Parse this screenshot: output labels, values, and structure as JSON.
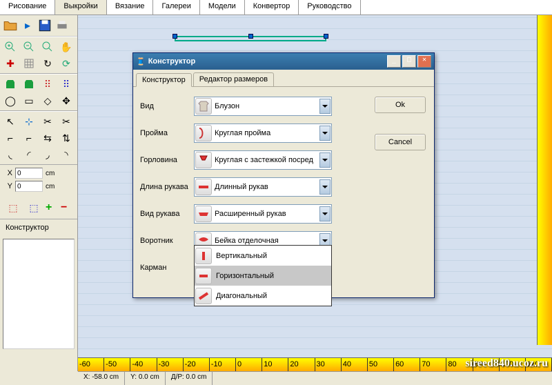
{
  "main_tabs": [
    "Рисование",
    "Выкройки",
    "Вязание",
    "Галереи",
    "Модели",
    "Конвертор",
    "Руководство"
  ],
  "main_tab_active_index": 1,
  "coords": {
    "x_label": "X",
    "y_label": "Y",
    "x_value": "0",
    "y_value": "0",
    "unit": "cm"
  },
  "constructor_label": "Конструктор",
  "statusbar": {
    "x": "X: -58.0 cm",
    "y": "Y: 0.0 cm",
    "dp": "Д/Р: 0.0 cm"
  },
  "ruler_bottom_ticks": [
    "-60",
    "-50",
    "-40",
    "-30",
    "-20",
    "-10",
    "0",
    "10",
    "20",
    "30",
    "40",
    "50",
    "60",
    "70",
    "80",
    "90",
    "100",
    "110"
  ],
  "watermark": "sireed840.ucoz.ru",
  "dialog": {
    "title": "Конструктор",
    "tabs": [
      "Конструктор",
      "Редактор размеров"
    ],
    "active_tab_index": 0,
    "ok": "Ok",
    "cancel": "Cancel",
    "fields": [
      {
        "label": "Вид",
        "value": "Блузон",
        "icon": "shirt"
      },
      {
        "label": "Пройма",
        "value": "Круглая пройма",
        "icon": "armhole"
      },
      {
        "label": "Горловина",
        "value": "Круглая с застежкой посред",
        "icon": "neckline"
      },
      {
        "label": "Длина рукава",
        "value": "Длинный рукав",
        "icon": "sleeve-long"
      },
      {
        "label": "Вид рукава",
        "value": "Расширенный рукав",
        "icon": "sleeve-wide"
      },
      {
        "label": "Воротник",
        "value": "Бейка отделочная",
        "icon": "collar"
      },
      {
        "label": "Карман",
        "value": "Горизонтальный",
        "icon": "pocket-horiz"
      }
    ],
    "dropdown_items": [
      {
        "label": "Вертикальный",
        "icon": "pocket-vert"
      },
      {
        "label": "Горизонтальный",
        "icon": "pocket-horiz"
      },
      {
        "label": "Диагональный",
        "icon": "pocket-diag"
      }
    ],
    "dropdown_selected_index": 1
  }
}
